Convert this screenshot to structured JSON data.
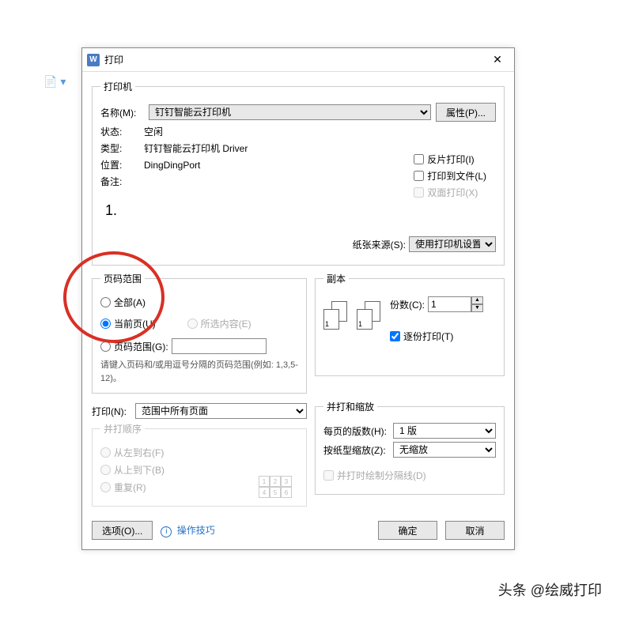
{
  "dialog": {
    "title": "打印",
    "close": "✕"
  },
  "printer": {
    "legend": "打印机",
    "name_label": "名称(M):",
    "name_value": "钉钉智能云打印机",
    "properties_button": "属性(P)...",
    "status_label": "状态:",
    "status_value": "空闲",
    "type_label": "类型:",
    "type_value": "钉钉智能云打印机 Driver",
    "location_label": "位置:",
    "location_value": "DingDingPort",
    "comment_label": "备注:",
    "comment_value": "",
    "reverse_print": "反片打印(I)",
    "print_to_file": "打印到文件(L)",
    "duplex": "双面打印(X)"
  },
  "num_one": "1.",
  "paper_source": {
    "label": "纸张来源(S):",
    "value": "使用打印机设置"
  },
  "page_range": {
    "legend": "页码范围",
    "all": "全部(A)",
    "current": "当前页(U)",
    "selection": "所选内容(E)",
    "pages": "页码范围(G):",
    "pages_value": "",
    "hint": "请键入页码和/或用逗号分隔的页码范围(例如: 1,3,5-12)。"
  },
  "copies": {
    "legend": "副本",
    "count_label": "份数(C):",
    "count_value": "1",
    "collate": "逐份打印(T)"
  },
  "print_what": {
    "label": "打印(N):",
    "value": "范围中所有页面"
  },
  "print_order": {
    "legend": "并打顺序",
    "lr": "从左到右(F)",
    "tb": "从上到下(B)",
    "repeat": "重复(R)"
  },
  "zoom": {
    "legend": "并打和缩放",
    "pages_per_sheet_label": "每页的版数(H):",
    "pages_per_sheet_value": "1 版",
    "scale_label": "按纸型缩放(Z):",
    "scale_value": "无缩放",
    "draw_borders": "并打时绘制分隔线(D)"
  },
  "bottom": {
    "options": "选项(O)...",
    "tips": "操作技巧",
    "ok": "确定",
    "cancel": "取消"
  },
  "watermark": "头条 @绘威打印"
}
